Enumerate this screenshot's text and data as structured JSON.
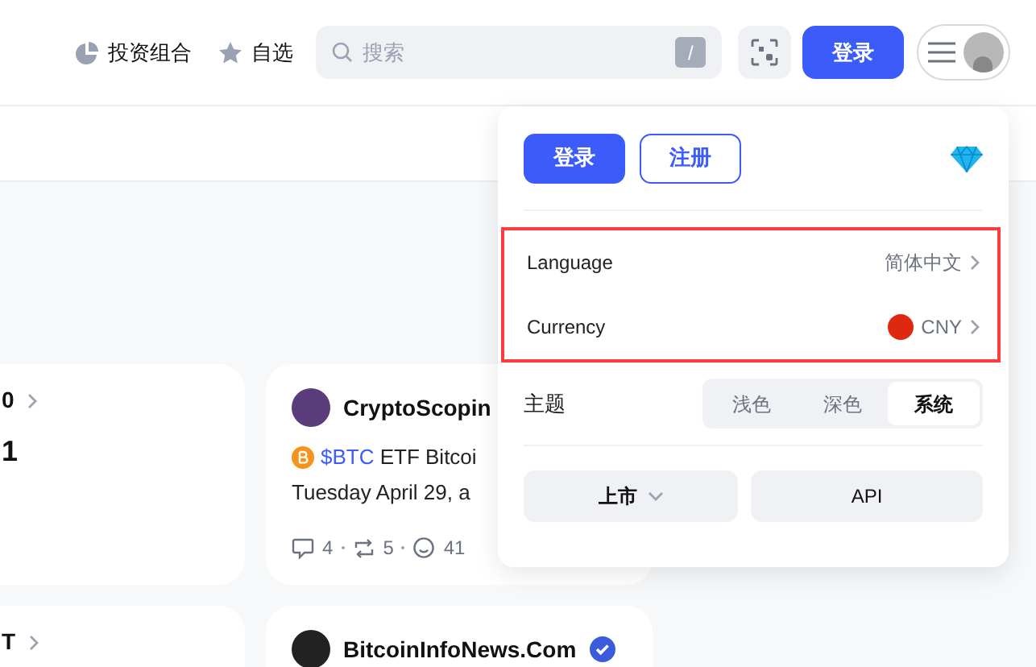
{
  "header": {
    "nav": [
      {
        "kind": "portfolio",
        "label": "投资组合"
      },
      {
        "kind": "watchlist",
        "label": "自选"
      }
    ],
    "search": {
      "placeholder": "搜索",
      "shortcut": "/"
    },
    "login_button": "登录"
  },
  "cards": [
    {
      "kind": "market",
      "title": "0",
      "value": "1"
    },
    {
      "kind": "post",
      "author": "CryptoScopin",
      "ticker": "$BTC",
      "text": " ETF Bitcoi",
      "line2": "Tuesday April 29, a",
      "comments": "4",
      "reposts": "5",
      "likes": "41"
    },
    {
      "kind": "market",
      "title": "T"
    },
    {
      "kind": "post",
      "author": "BitcoinInfoNews.Com",
      "verified": true
    }
  ],
  "menu": {
    "login": "登录",
    "register": "注册",
    "settings": [
      {
        "label": "Language",
        "value": "简体中文",
        "flag": false
      },
      {
        "label": "Currency",
        "value": "CNY",
        "flag": true
      }
    ],
    "highlighted": true,
    "theme": {
      "label": "主题",
      "options": [
        {
          "label": "浅色",
          "selected": false
        },
        {
          "label": "深色",
          "selected": false
        },
        {
          "label": "系统",
          "selected": true
        }
      ]
    },
    "buttons": [
      {
        "label": "上市",
        "dropdown": true
      },
      {
        "label": "API",
        "dropdown": false
      }
    ]
  }
}
